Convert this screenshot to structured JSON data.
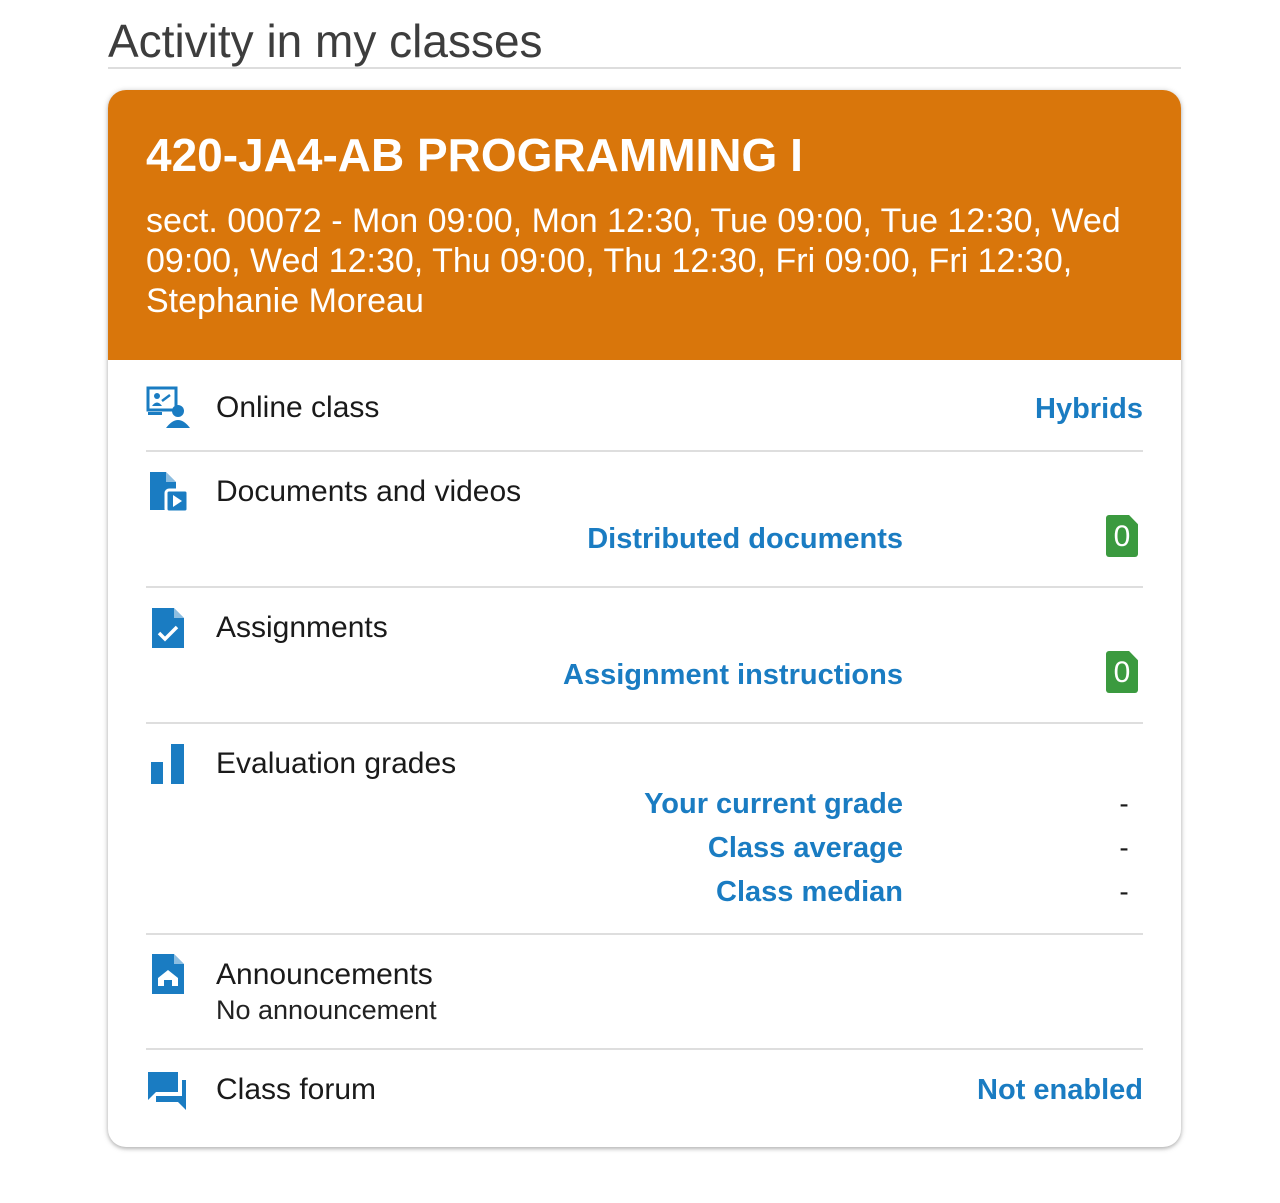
{
  "page": {
    "heading": "Activity in my classes"
  },
  "course": {
    "title": "420-JA4-AB PROGRAMMING I",
    "schedule": "sect. 00072 - Mon 09:00, Mon 12:30, Tue 09:00, Tue 12:30, Wed 09:00, Wed 12:30, Thu 09:00, Thu 12:30, Fri 09:00, Fri 12:30, Stephanie Moreau",
    "header_color": "#d9760b"
  },
  "online_class": {
    "icon": "online-class-icon",
    "label": "Online class",
    "value": "Hybrids"
  },
  "documents": {
    "icon": "document-video-icon",
    "label": "Documents and videos",
    "link_label": "Distributed documents",
    "count": "0"
  },
  "assignments": {
    "icon": "assignment-check-icon",
    "label": "Assignments",
    "link_label": "Assignment instructions",
    "count": "0"
  },
  "grades": {
    "icon": "bar-chart-icon",
    "label": "Evaluation grades",
    "rows": [
      {
        "label": "Your current grade",
        "value": "-"
      },
      {
        "label": "Class average",
        "value": "-"
      },
      {
        "label": "Class median",
        "value": "-"
      }
    ]
  },
  "announcements": {
    "icon": "announcement-icon",
    "label": "Announcements",
    "status": "No announcement"
  },
  "forum": {
    "icon": "forum-chat-icon",
    "label": "Class forum",
    "value": "Not enabled"
  },
  "colors": {
    "link": "#1a7cc2",
    "icon": "#1a7cc2",
    "badge": "#3b9a3f"
  }
}
